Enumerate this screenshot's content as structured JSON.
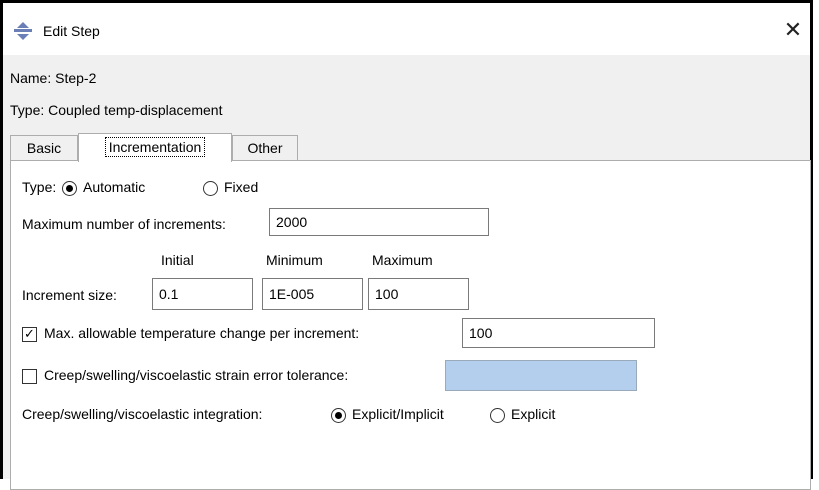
{
  "window": {
    "title": "Edit Step",
    "close_glyph": "✕",
    "icon": "step-icon"
  },
  "step": {
    "name_label": "Name:",
    "name_value": "Step-2",
    "type_label": "Type:",
    "type_value": "Coupled temp-displacement"
  },
  "tabs": [
    {
      "label": "Basic",
      "active": false
    },
    {
      "label": "Incrementation",
      "active": true
    },
    {
      "label": "Other",
      "active": false
    }
  ],
  "incrementation": {
    "type_label": "Type:",
    "type_options": [
      {
        "label": "Automatic",
        "selected": true
      },
      {
        "label": "Fixed",
        "selected": false
      }
    ],
    "max_increments_label": "Maximum number of increments:",
    "max_increments_value": "2000",
    "col_initial": "Initial",
    "col_minimum": "Minimum",
    "col_maximum": "Maximum",
    "increment_size_label": "Increment size:",
    "initial_value": "0.1",
    "minimum_value": "1E-005",
    "maximum_value": "100",
    "max_temp_change_checked": true,
    "max_temp_change_label": "Max. allowable temperature change per  increment:",
    "max_temp_change_value": "100",
    "creep_tolerance_checked": false,
    "creep_tolerance_label": "Creep/swelling/viscoelastic strain error tolerance:",
    "creep_tolerance_value": "",
    "creep_integration_label": "Creep/swelling/viscoelastic integration:",
    "creep_integration_options": [
      {
        "label": "Explicit/Implicit",
        "selected": true
      },
      {
        "label": "Explicit",
        "selected": false
      }
    ]
  }
}
